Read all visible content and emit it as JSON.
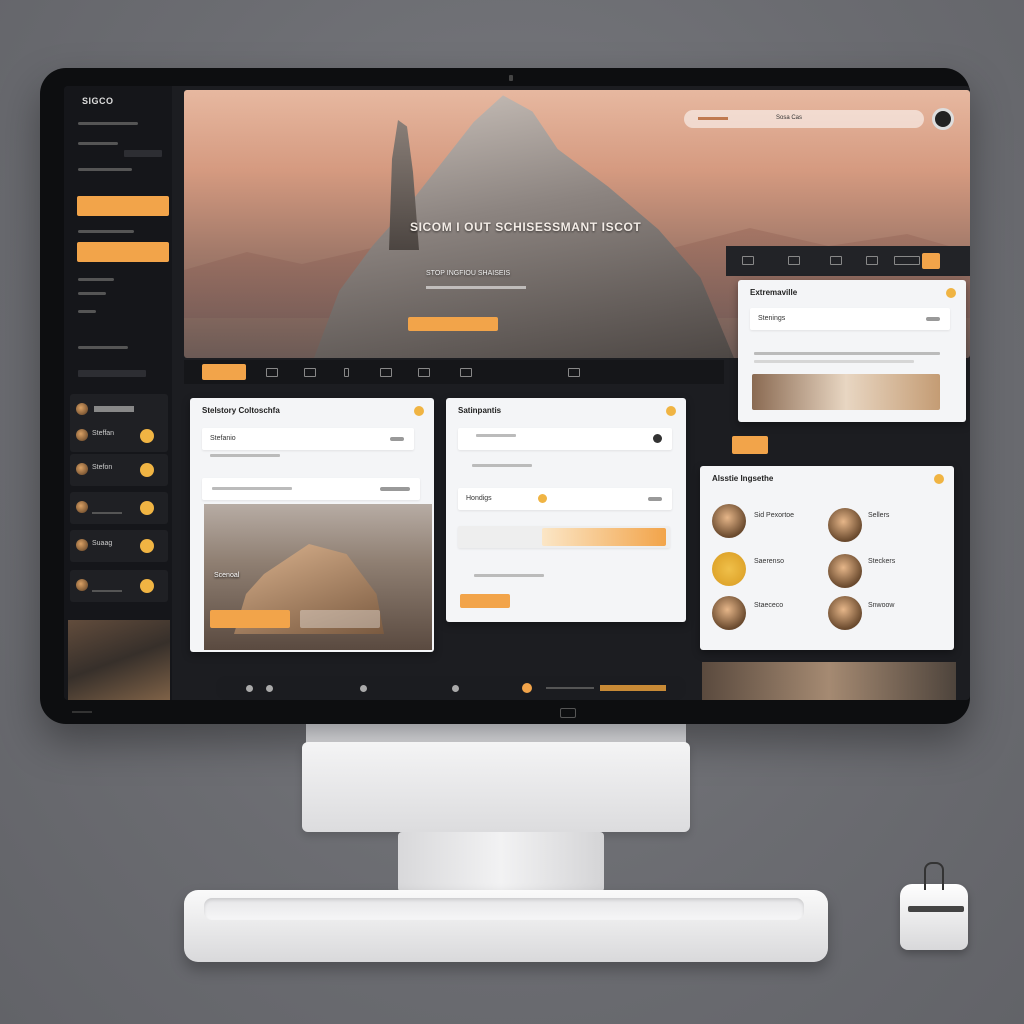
{
  "sidebar": {
    "brand": "SIGCO",
    "contacts": [
      {
        "name": "Steffan"
      },
      {
        "name": "Stefon"
      },
      {
        "name": ""
      },
      {
        "name": "Suaag"
      },
      {
        "name": ""
      }
    ]
  },
  "hero": {
    "headline": "SICOM I OUT SCHISESSMANT ISCOT",
    "subline": "STOP  INGFIOU  SHAISEIS",
    "search_label": "Sosa Cas"
  },
  "cards": {
    "mid_left_title": "Stelstory Coltoschfa",
    "mid_left_row1": "Stefanio",
    "mid_left_photo_caption": "Scenoal",
    "mid_center_title": "Satinpantis",
    "mid_center_row": "Hondigs",
    "right_top_title": "Extremaville",
    "right_top_row": "Stenings",
    "right_bottom_title": "Alsstie Ingsethe"
  },
  "people": [
    {
      "name": "Sid Pexortoe"
    },
    {
      "name": "Sellers"
    },
    {
      "name": "Saerenso"
    },
    {
      "name": "Steckers"
    },
    {
      "name": "Staececo"
    },
    {
      "name": "Snwoow"
    }
  ],
  "colors": {
    "accent": "#f2a44a",
    "dark": "#15161a",
    "card": "#f4f5f7"
  }
}
